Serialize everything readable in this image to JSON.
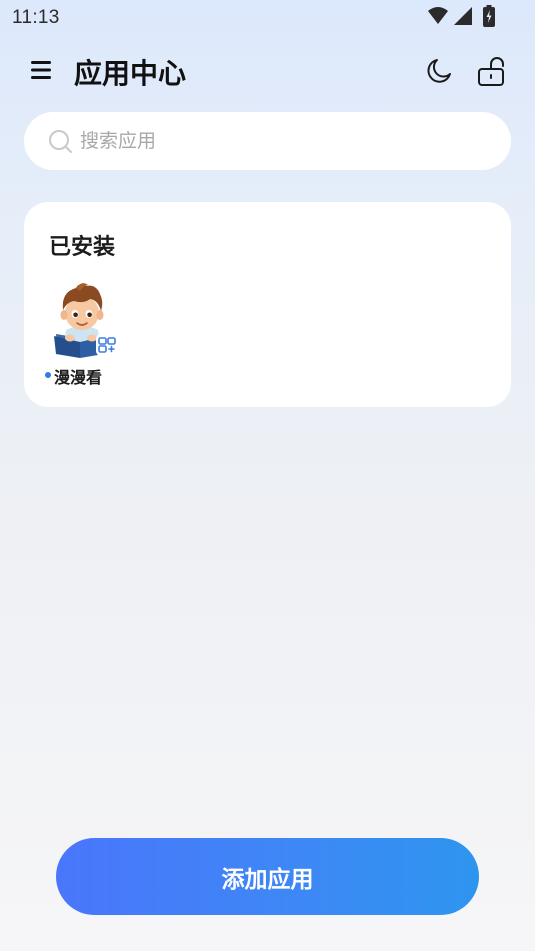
{
  "status_bar": {
    "time": "11:13",
    "icons": [
      "wifi-icon",
      "cellular-signal-icon",
      "battery-charging-icon"
    ]
  },
  "header": {
    "title": "应用中心",
    "menu_icon": "menu-icon",
    "theme_icon": "moon-icon",
    "lock_icon": "unlock-icon"
  },
  "search": {
    "placeholder": "搜索应用",
    "value": ""
  },
  "installed": {
    "title": "已安装",
    "apps": [
      {
        "name": "漫漫看",
        "icon": "boy-reading-book-avatar",
        "badge": "grid-badge-icon",
        "has_update_dot": true
      }
    ]
  },
  "actions": {
    "add_app_label": "添加应用"
  },
  "colors": {
    "accent": "#3e87f6",
    "button_start": "#4a76fb",
    "button_end": "#2e95ef",
    "dot": "#2f7be8",
    "background_top": "#dce8fb",
    "background_bottom": "#f6f6f8"
  }
}
